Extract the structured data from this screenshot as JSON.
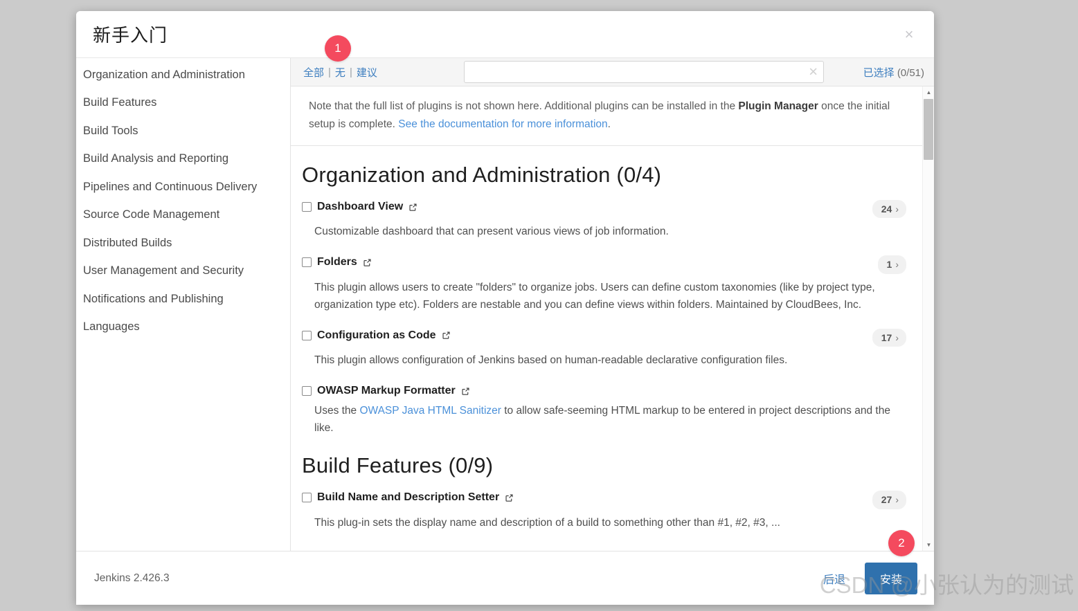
{
  "window": {
    "title": "新手入门",
    "close_label": "×"
  },
  "sidebar": {
    "items": [
      {
        "label": "Organization and Administration"
      },
      {
        "label": "Build Features"
      },
      {
        "label": "Build Tools"
      },
      {
        "label": "Build Analysis and Reporting"
      },
      {
        "label": "Pipelines and Continuous Delivery"
      },
      {
        "label": "Source Code Management"
      },
      {
        "label": "Distributed Builds"
      },
      {
        "label": "User Management and Security"
      },
      {
        "label": "Notifications and Publishing"
      },
      {
        "label": "Languages"
      }
    ]
  },
  "filter_bar": {
    "all_label": "全部",
    "none_label": "无",
    "suggested_label": "建议",
    "separator": "|",
    "search_value": "",
    "search_placeholder": "",
    "search_clear_icon": "✕",
    "selected_label": "已选择",
    "selected_count": "(0/51)"
  },
  "note": {
    "text_1": "Note that the full list of plugins is not shown here. Additional plugins can be installed in the ",
    "bold": "Plugin Manager",
    "text_2": " once the initial setup is complete. ",
    "link": "See the documentation for more information",
    "text_3": "."
  },
  "sections": [
    {
      "title": "Organization and Administration (0/4)",
      "plugins": [
        {
          "name": "Dashboard View",
          "badge": "24",
          "chevron": "›",
          "description": "Customizable dashboard that can present various views of job information."
        },
        {
          "name": "Folders",
          "badge": "1",
          "chevron": "›",
          "description": "This plugin allows users to create \"folders\" to organize jobs. Users can define custom taxonomies (like by project type, organization type etc). Folders are nestable and you can define views within folders. Maintained by CloudBees, Inc."
        },
        {
          "name": "Configuration as Code",
          "badge": "17",
          "chevron": "›",
          "description": "This plugin allows configuration of Jenkins based on human-readable declarative configuration files."
        },
        {
          "name": "OWASP Markup Formatter",
          "badge": "",
          "chevron": "",
          "description_before": "Uses the ",
          "description_link": "OWASP Java HTML Sanitizer",
          "description_after": " to allow safe-seeming HTML markup to be entered in project descriptions and the like."
        }
      ]
    },
    {
      "title": "Build Features (0/9)",
      "plugins": [
        {
          "name": "Build Name and Description Setter",
          "badge": "27",
          "chevron": "›",
          "description": "This plug-in sets the display name and description of a build to something other than #1, #2, #3, ..."
        }
      ]
    }
  ],
  "scrollbar": {
    "up_arrow": "▲",
    "down_arrow": "▼"
  },
  "footer": {
    "version": "Jenkins 2.426.3",
    "back_label": "后退",
    "install_label": "安装"
  },
  "annotations": [
    {
      "number": "1"
    },
    {
      "number": "2"
    }
  ],
  "watermark": {
    "text": "CSDN @小张认为的测试"
  },
  "colors": {
    "accent_blue": "#2f71ad",
    "link_blue": "#4a90d9",
    "annotation_red": "#f44a5e",
    "page_background": "#cbcbcb"
  }
}
